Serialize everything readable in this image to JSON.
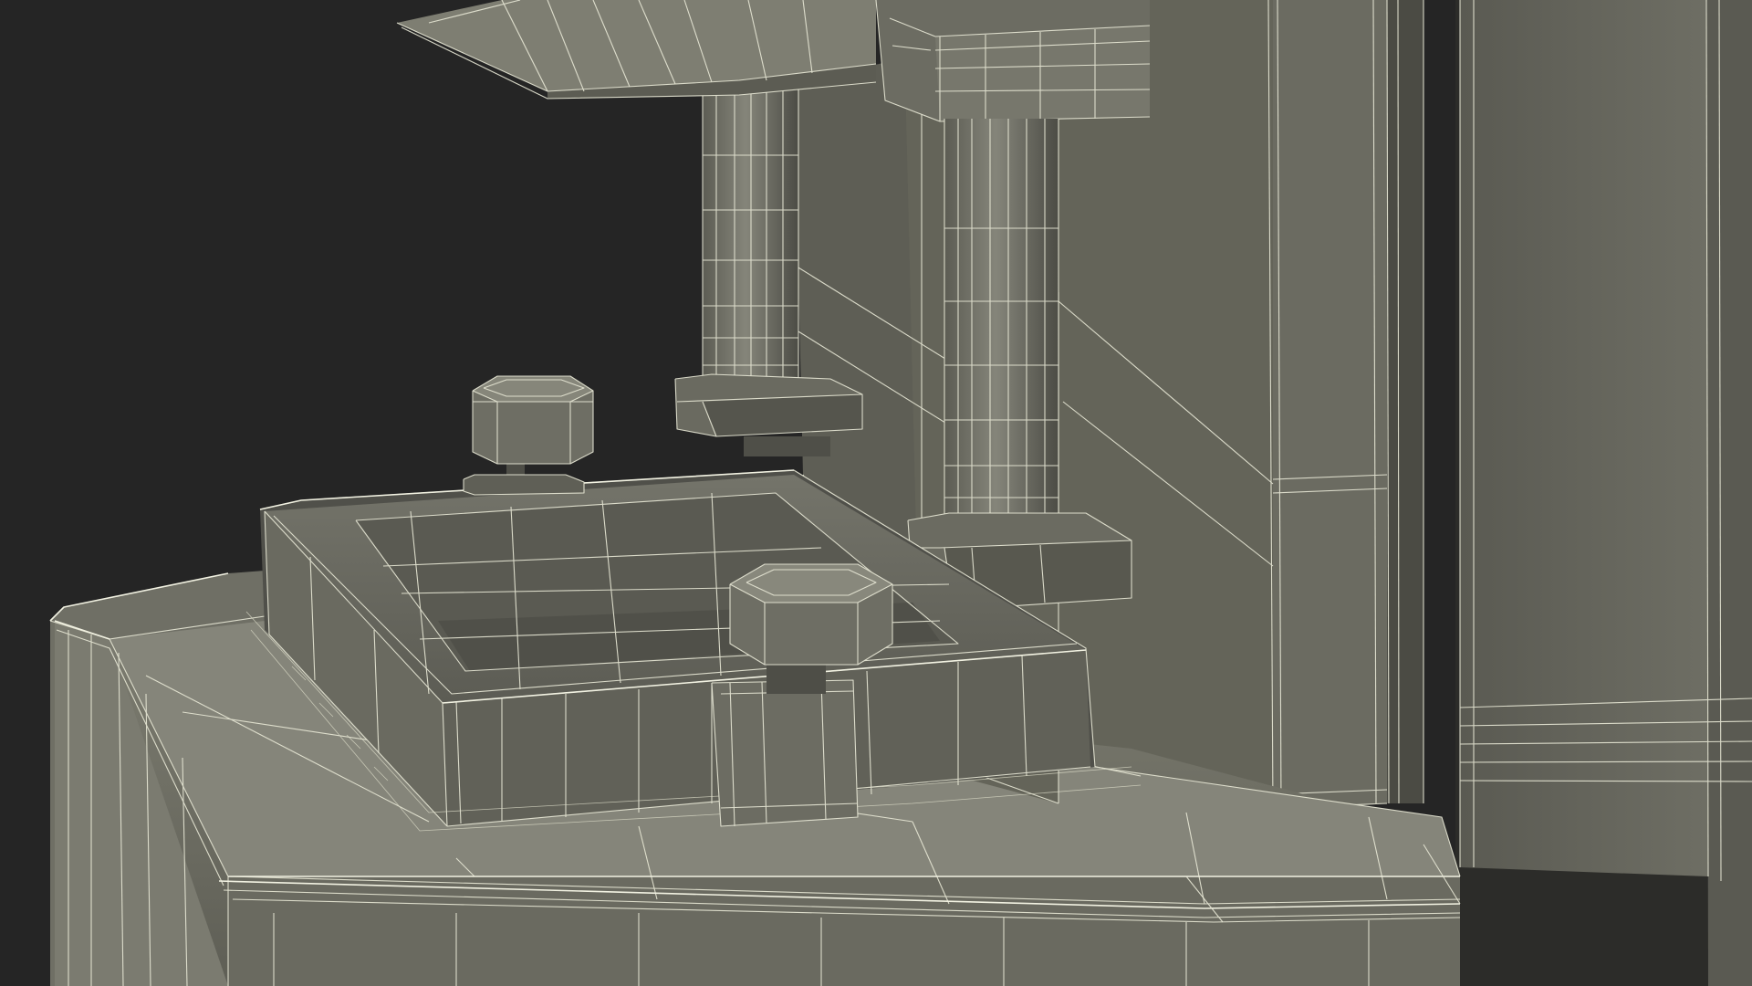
{
  "scene": {
    "subject": "",
    "palette": {
      "background": "#252525",
      "body_light": "#7e7e72",
      "body_mid": "#6c6c62",
      "body_dark": "#55554d",
      "body_shadow": "#3e3e38",
      "wire": "#e6e6d4"
    }
  }
}
